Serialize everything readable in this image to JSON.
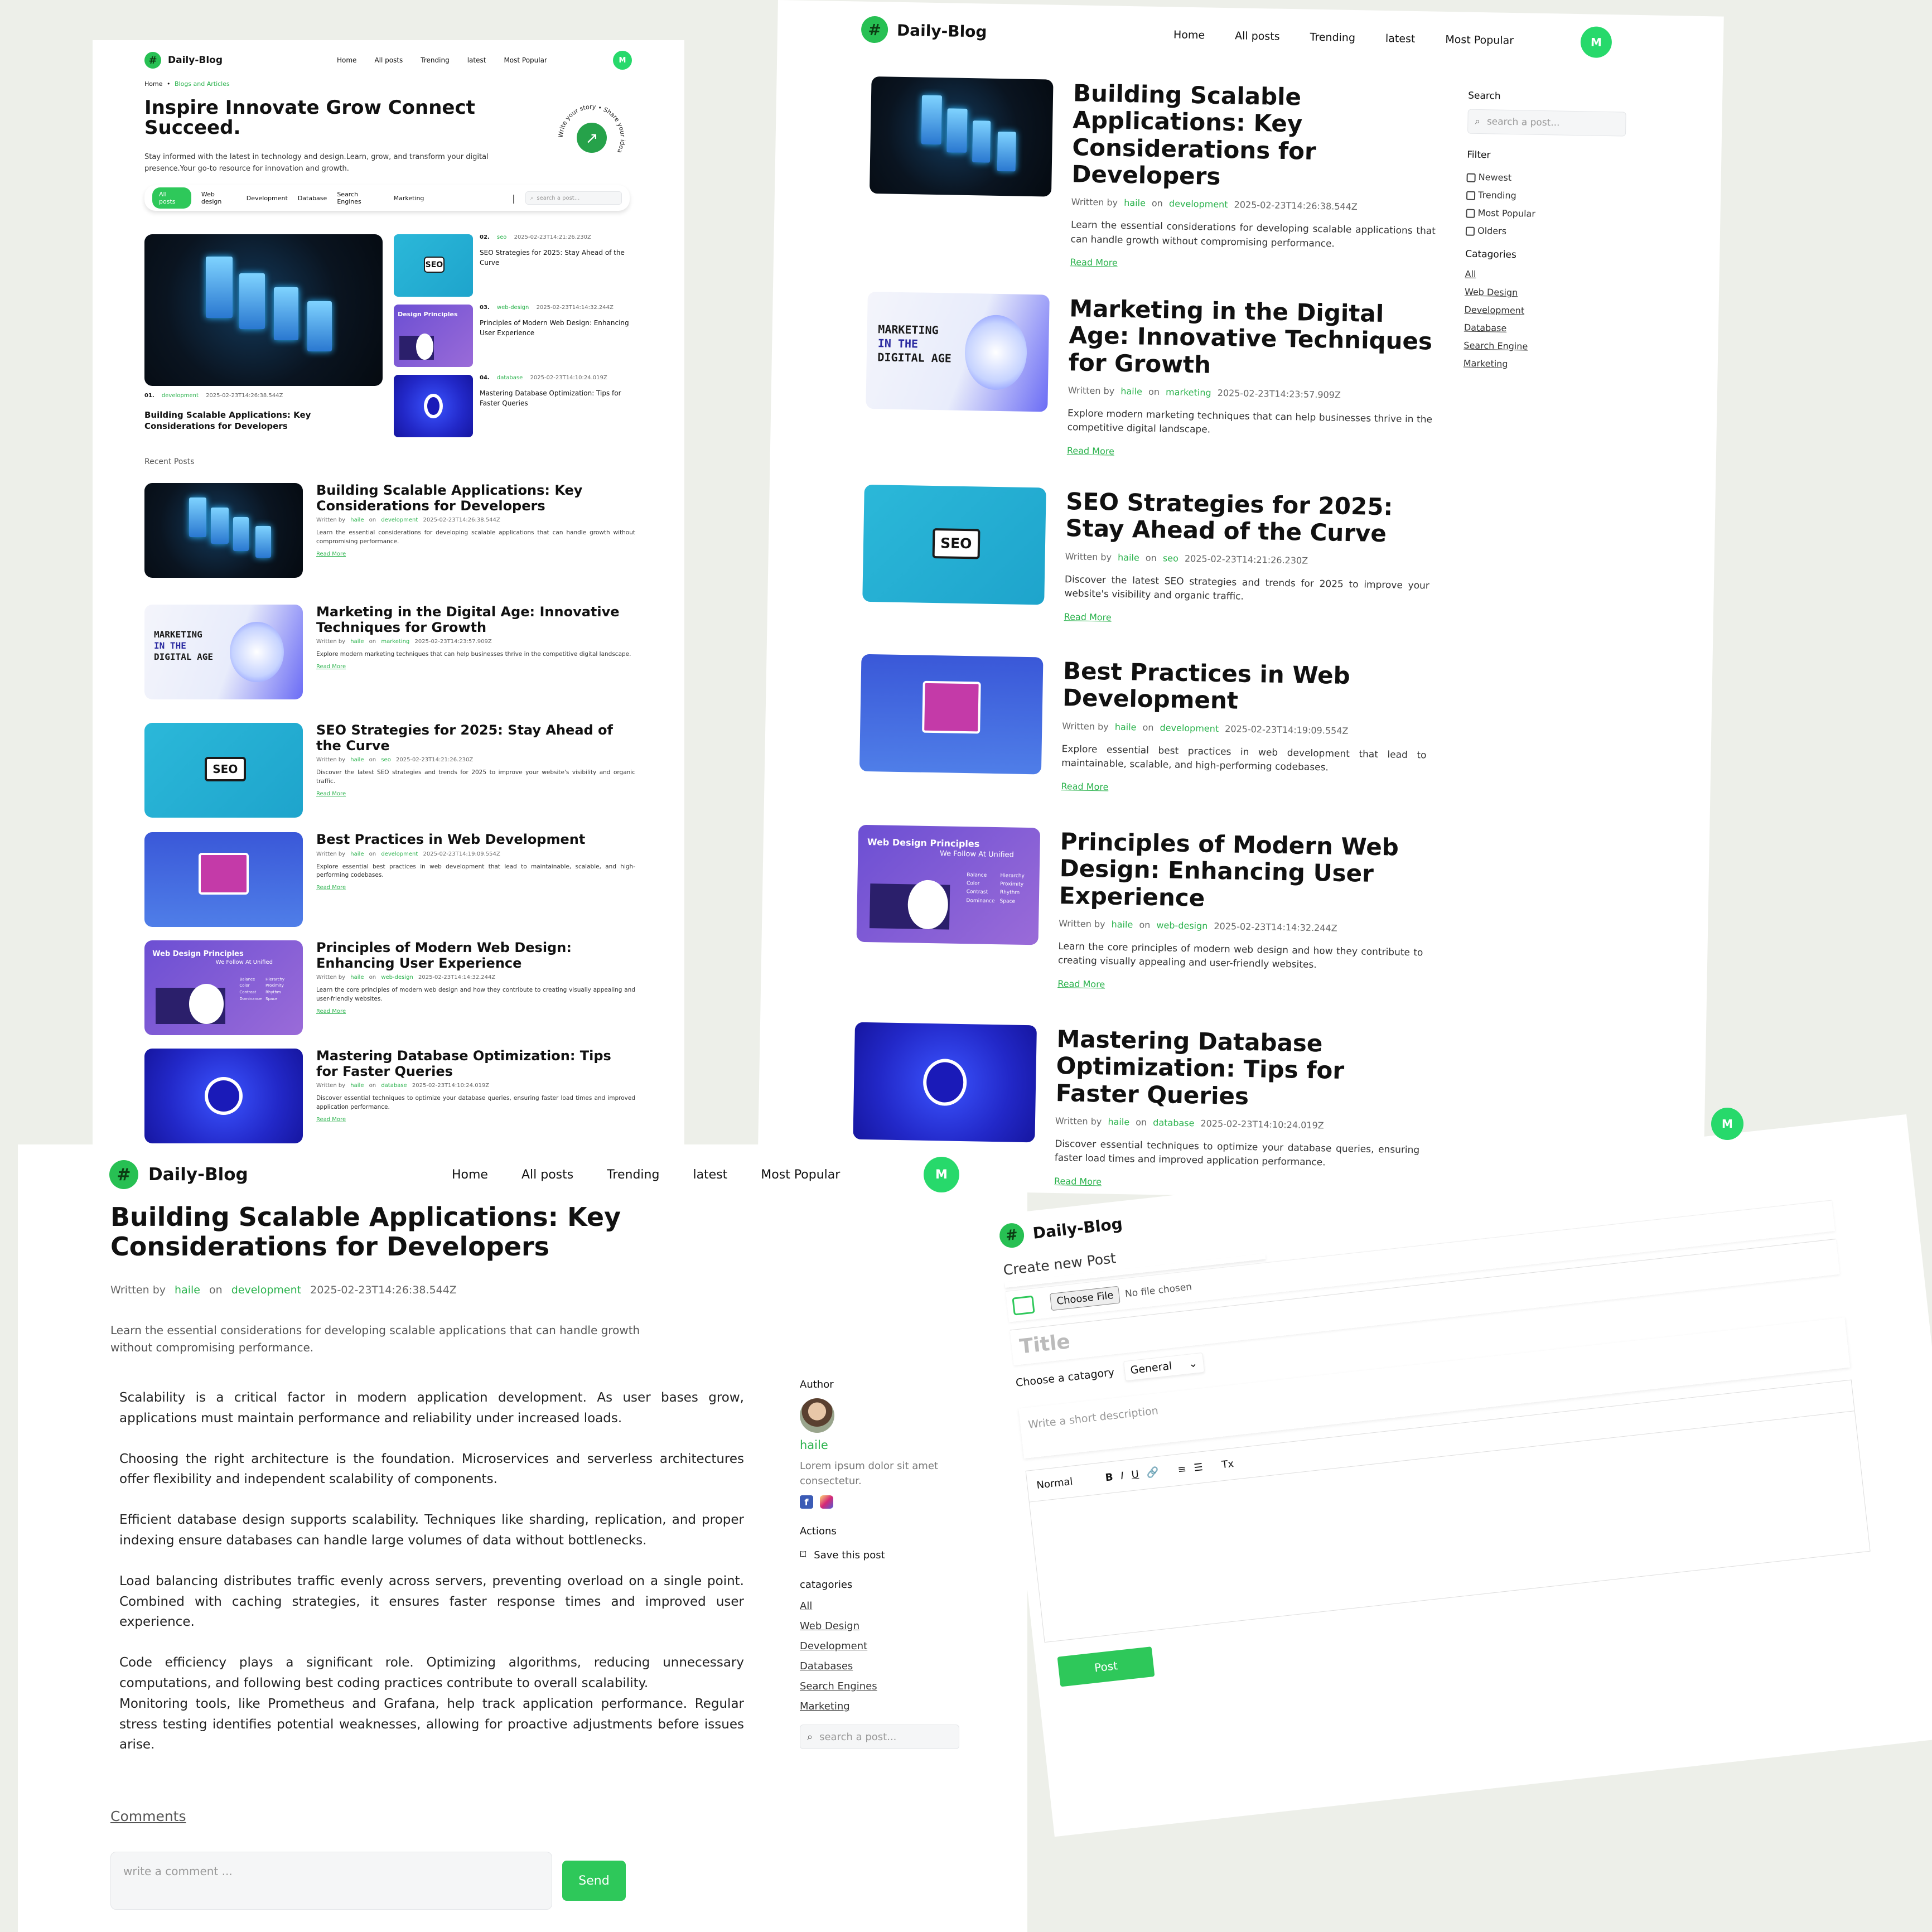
{
  "brand": {
    "name": "Daily-Blog",
    "avatar_initial": "M"
  },
  "nav": [
    "Home",
    "All posts",
    "Trending",
    "latest",
    "Most Popular"
  ],
  "colors": {
    "accent": "#2ec85a",
    "avatar": "#27d96b",
    "page_bg": "#edefe9"
  },
  "posts": [
    {
      "title": "Building Scalable Applications: Key Considerations for Developers",
      "author": "haile",
      "category": "development",
      "date": "2025-02-23T14:26:38.544Z",
      "summary": "Learn the essential considerations for developing scalable applications that can handle growth without compromising performance.",
      "read_more": "Read More"
    },
    {
      "title": "Marketing in the Digital Age: Innovative Techniques for Growth",
      "author": "haile",
      "category": "marketing",
      "date": "2025-02-23T14:23:57.909Z",
      "summary": "Explore modern marketing techniques that can help businesses thrive in the competitive digital landscape.",
      "read_more": "Read More"
    },
    {
      "title": "SEO Strategies for 2025: Stay Ahead of the Curve",
      "author": "haile",
      "category": "seo",
      "date": "2025-02-23T14:21:26.230Z",
      "summary": "Discover the latest SEO strategies and trends for 2025 to improve your website's visibility and organic traffic.",
      "read_more": "Read More"
    },
    {
      "title": "Best Practices in Web Development",
      "author": "haile",
      "category": "development",
      "date": "2025-02-23T14:19:09.554Z",
      "summary": "Explore essential best practices in web development that lead to maintainable, scalable, and high-performing codebases.",
      "read_more": "Read More"
    },
    {
      "title": "Principles of Modern Web Design: Enhancing User Experience",
      "author": "haile",
      "category": "web-design",
      "date": "2025-02-23T14:14:32.244Z",
      "summary": "Learn the core principles of modern web design and how they contribute to creating visually appealing and user-friendly websites.",
      "read_more": "Read More"
    },
    {
      "title": "Mastering Database Optimization: Tips for Faster Queries",
      "author": "haile",
      "category": "database",
      "date": "2025-02-23T14:10:24.019Z",
      "summary": "Discover essential techniques to optimize your database queries, ensuring faster load times and improved application performance.",
      "read_more": "Read More"
    }
  ],
  "meta_words": {
    "written_by": "Written by",
    "on": "on"
  },
  "thumb_text": {
    "seo": "SEO",
    "marketing": [
      "MARKETING",
      "IN THE",
      "DIGITAL AGE"
    ],
    "design_title": "Web Design Principles",
    "design_subtitle": "We Follow At Unified",
    "design_title_small": "Design Principles",
    "design_subtitle_small": "We Follow At Unified",
    "design_items": [
      "Balance",
      "Color",
      "Contrast",
      "Dominance",
      "Hierarchy",
      "Proximity",
      "Rhythm",
      "Space"
    ]
  },
  "home": {
    "breadcrumb_home": "Home",
    "breadcrumb_sep": "•",
    "breadcrumb_current": "Blogs and Articles",
    "hero_title": "Inspire Innovate Grow Connect Succeed.",
    "hero_sub": "Stay informed with the latest in technology and design.Learn, grow, and transform your digital presence.Your go-to resource for innovation and growth.",
    "circle_text": "Write your story • Share your idea",
    "filters": [
      "All posts",
      "Web design",
      "Development",
      "Database",
      "Search Engines",
      "Marketing"
    ],
    "divider": "|",
    "search_placeholder": "search a post...",
    "featured_num": "01.",
    "side_items": [
      {
        "num": "02.",
        "cat": "seo",
        "date": "2025-02-23T14:21:26.230Z",
        "title": "SEO Strategies for 2025: Stay Ahead of the Curve"
      },
      {
        "num": "03.",
        "cat": "web-design",
        "date": "2025-02-23T14:14:32.244Z",
        "title": "Principles of Modern Web Design: Enhancing User Experience"
      },
      {
        "num": "04.",
        "cat": "database",
        "date": "2025-02-23T14:10:24.019Z",
        "title": "Mastering Database Optimization: Tips for Faster Queries"
      }
    ],
    "recent_label": "Recent Posts"
  },
  "list_page": {
    "search_label": "Search",
    "search_placeholder": "search a post...",
    "filter_label": "Filter",
    "filters": [
      "Newest",
      "Trending",
      "Most Popular",
      "Olders"
    ],
    "categories_label": "Catagories",
    "categories": [
      "All",
      "Web Design",
      "Development",
      "Database",
      "Search Engine",
      "Marketing"
    ]
  },
  "detail": {
    "paragraphs": [
      "Scalability is a critical factor in modern application development. As user bases grow, applications must maintain performance and reliability under increased loads.",
      "Choosing the right architecture is the foundation. Microservices and serverless architectures offer flexibility and independent scalability of components.",
      "Efficient database design supports scalability. Techniques like sharding, replication, and proper indexing ensure databases can handle large volumes of data without bottlenecks.",
      "Load balancing distributes traffic evenly across servers, preventing overload on a single point. Combined with caching strategies, it ensures faster response times and improved user experience.",
      "Code efficiency plays a significant role. Optimizing algorithms, reducing unnecessary computations, and following best coding practices contribute to overall scalability.\nMonitoring tools, like Prometheus and Grafana, help track application performance. Regular stress testing identifies potential weaknesses, allowing for proactive adjustments before issues arise."
    ],
    "author_label": "Author",
    "author_name": "haile",
    "author_bio": "Lorem ipsum dolor sit amet consectetur.",
    "actions_label": "Actions",
    "save_label": "Save this post",
    "categories_label": "catagories",
    "categories": [
      "All",
      "Web Design",
      "Development",
      "Databases",
      "Search Engines",
      "Marketing"
    ],
    "search_placeholder": "search a post...",
    "comments_label": "Comments",
    "comment_placeholder": "write a comment ...",
    "send_label": "Send"
  },
  "create": {
    "heading": "Create new Post",
    "choose_file": "Choose File",
    "no_file": "No file chosen",
    "title_placeholder": "Title",
    "category_label": "Choose a catagory",
    "category_value": "General",
    "desc_placeholder": "Write a short description",
    "format_value": "Normal",
    "toolbar": [
      "B",
      "I",
      "U",
      "🔗",
      "≡",
      "☰",
      "Tx"
    ],
    "post_button": "Post"
  }
}
